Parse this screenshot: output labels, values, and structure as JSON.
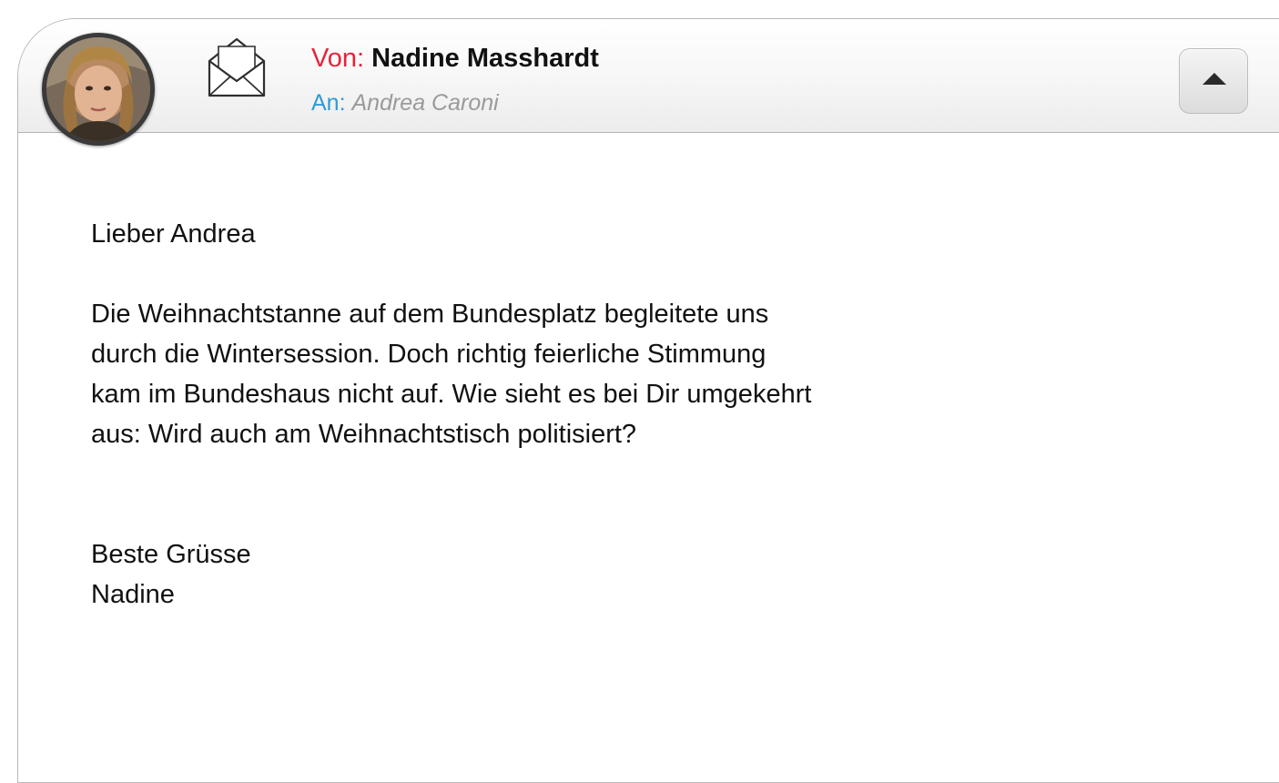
{
  "header": {
    "from_label": "Von:",
    "from_name": "Nadine Masshardt",
    "to_label": "An:",
    "to_name": "Andrea Caroni",
    "avatar_icon": "avatar-photo",
    "envelope_icon": "open-envelope-icon",
    "collapse_icon": "triangle-up-icon"
  },
  "message": {
    "greeting": "Lieber Andrea",
    "body": "Die Weihnachtstanne auf dem Bundesplatz begleitete uns\ndurch die Wintersession. Doch richtig feierliche Stimmung\nkam im Bundeshaus nicht auf. Wie sieht es bei Dir umgekehrt\naus: Wird auch am Weihnachtstisch politisiert?",
    "closing": "Beste Grüsse",
    "signature": "Nadine"
  },
  "colors": {
    "from_label": "#e8223a",
    "to_label": "#2f9ad9",
    "to_name": "#9a9a9a",
    "text": "#111111",
    "border": "#b9b9b9"
  }
}
